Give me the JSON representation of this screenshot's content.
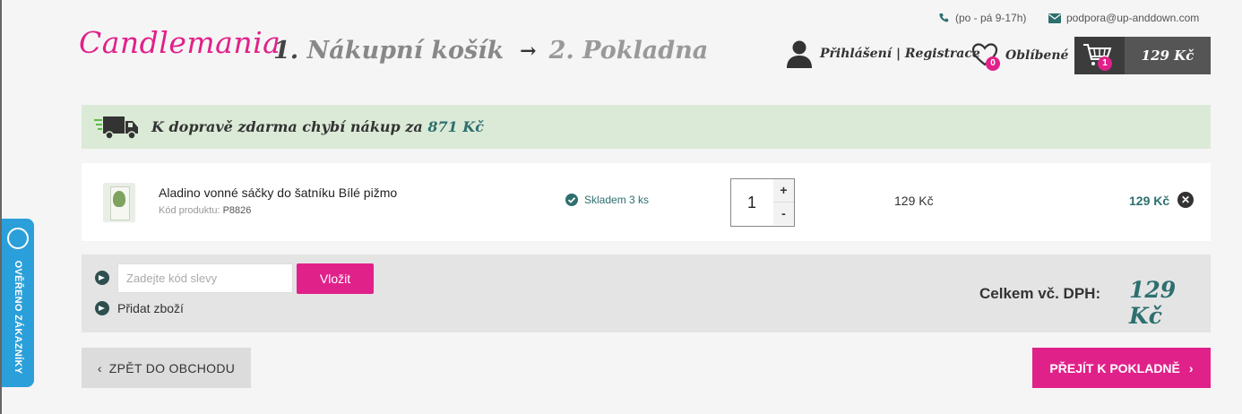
{
  "header": {
    "phone": "(po - pá 9-17h)",
    "email": "podpora@up-anddown.com",
    "logo": "Candlemania",
    "step1_num": "1.",
    "step1_label": "Nákupní košík",
    "step_arrow": "→",
    "step2": "2. Pokladna",
    "login": "Přihlášení | Registrace",
    "favorites_label": "Oblíbené",
    "favorites_count": "0",
    "cart_count": "1",
    "cart_price": "129 Kč"
  },
  "shipping": {
    "message": "K dopravě zdarma chybí nákup za",
    "amount": "871 Kč"
  },
  "cart_items": [
    {
      "name": "Aladino vonné sáčky do šatníku Bílé pižmo",
      "code_label": "Kód produktu:",
      "code": "P8826",
      "stock": "Skladem 3 ks",
      "quantity": "1",
      "unit_price": "129 Kč",
      "total_price": "129 Kč"
    }
  ],
  "qty_controls": {
    "plus": "+",
    "minus": "-"
  },
  "coupon": {
    "placeholder": "Zadejte kód slevy",
    "apply_label": "Vložit",
    "add_items": "Přidat zboží"
  },
  "summary": {
    "label": "Celkem vč. DPH:",
    "value": "129 Kč"
  },
  "actions": {
    "back": "ZPĚT DO OBCHODU",
    "checkout": "PŘEJÍT K POKLADNĚ"
  },
  "verified_badge": "OVĚŘENO ZÁKAZNÍKY",
  "colors": {
    "brand_pink": "#e0218a",
    "teal": "#2e6f6f",
    "shipping_bg": "#dbead7",
    "badge_blue": "#2b9fd9"
  }
}
